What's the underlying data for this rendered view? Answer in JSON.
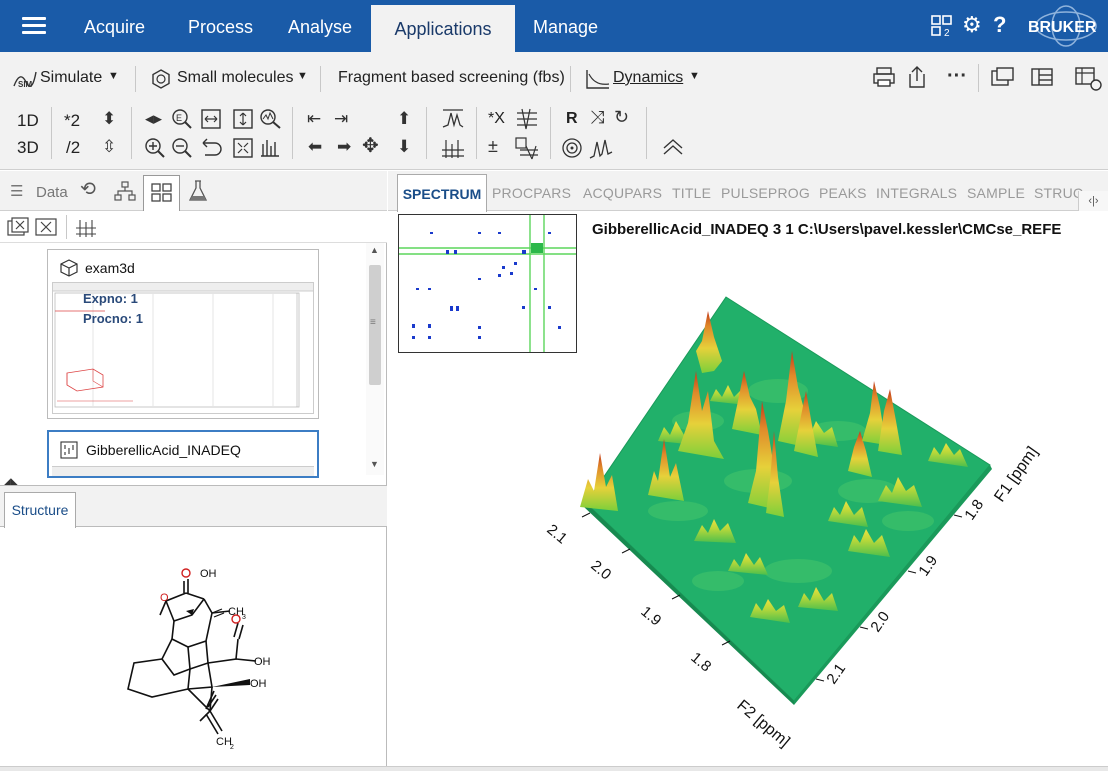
{
  "menubar": {
    "items": [
      {
        "label": "Acquire"
      },
      {
        "label": "Process"
      },
      {
        "label": "Analyse"
      },
      {
        "label": "Applications"
      },
      {
        "label": "Manage"
      }
    ],
    "right_icons": [
      "layout-icon",
      "settings-gear-icon",
      "help-icon"
    ],
    "brand": "BRUKER",
    "colors": {
      "bar": "#1a5ba8",
      "active_tab_bg": "#f2f2f2"
    }
  },
  "ribbon": {
    "apps": {
      "simulate": "Simulate",
      "sim_badge": "SIM",
      "small_molecules": "Small molecules",
      "fbs": "Fragment based screening (fbs)",
      "dynamics": "Dynamics"
    },
    "dim_1d": "1D",
    "dim_3d": "3D",
    "scale_up": "*2",
    "scale_down": "/2",
    "mult_x": "*X",
    "reset_r": "R"
  },
  "left_panel": {
    "tabs": {
      "data": "Data"
    },
    "datasets": [
      {
        "name": "exam3d",
        "line1": "Expno: 1",
        "line2": "Procno: 1"
      },
      {
        "name": "GibberellicAcid_INADEQ"
      }
    ],
    "structure_tab": "Structure",
    "molecule_labels": {
      "oh_top": "OH",
      "o_ring": "O",
      "ch3": "CH",
      "ch3_sub": "3",
      "oh_acid": "OH",
      "oh_bottom": "OH",
      "ch2": "CH",
      "ch2_sub": "2"
    }
  },
  "right_panel": {
    "tabs": [
      "SPECTRUM",
      "PROCPARS",
      "ACQUPARS",
      "TITLE",
      "PULSEPROG",
      "PEAKS",
      "INTEGRALS",
      "SAMPLE",
      "STRUC"
    ],
    "spectrum_title": "GibberellicAcid_INADEQ  3  1  C:\\Users\\pavel.kessler\\CMCse_REFE",
    "plot": {
      "type": "3d-surface",
      "f2_label": "F2 [ppm]",
      "f1_label": "F1 [ppm]",
      "f2_ticks": [
        "2.1",
        "2.0",
        "1.9",
        "1.8"
      ],
      "f1_ticks": [
        "2.1",
        "2.0",
        "1.9",
        "1.8"
      ]
    }
  }
}
